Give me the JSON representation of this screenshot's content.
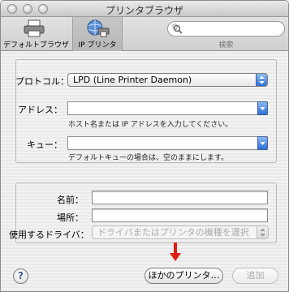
{
  "window": {
    "title": "プリンタブラウザ"
  },
  "toolbar": {
    "default_browser_label": "デフォルトブラウザ",
    "ip_printer_label": "IP プリンタ",
    "search_placeholder": "Q-",
    "search_label": "検索"
  },
  "connection": {
    "protocol_label": "プロトコル：",
    "protocol_value": "LPD (Line Printer Daemon)",
    "address_label": "アドレス：",
    "address_value": "",
    "address_hint": "ホスト名または IP アドレスを入力してください。",
    "queue_label": "キュー：",
    "queue_value": "",
    "queue_hint": "デフォルトキューの場合は、空のままにします。"
  },
  "printer_info": {
    "name_label": "名前：",
    "name_value": "",
    "location_label": "場所：",
    "location_value": "",
    "driver_label": "使用するドライバ：",
    "driver_value": "ドライバまたはプリンタの機種を選択"
  },
  "footer": {
    "help_label": "?",
    "more_printers_label": "ほかのプリンタ…",
    "add_label": "追加"
  },
  "colors": {
    "accent_blue": "#2c6fd8",
    "annotation_red": "#e02010"
  }
}
